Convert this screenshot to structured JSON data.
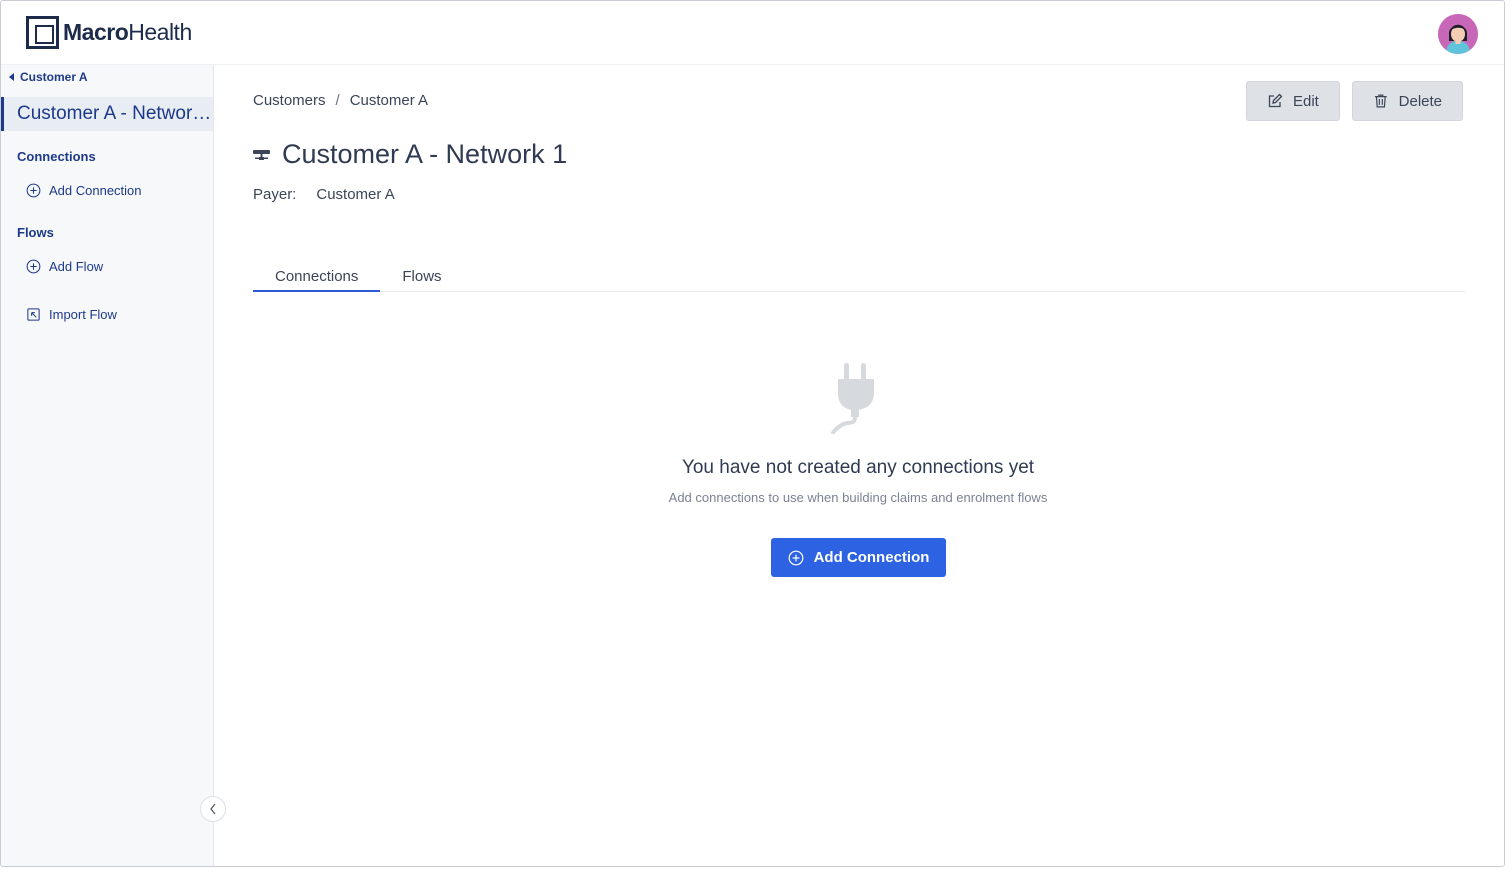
{
  "app": {
    "logo_bold": "Macro",
    "logo_light": "Health"
  },
  "sidebar": {
    "back_label": "Customer A",
    "current_item": "Customer A - Network 1",
    "sections": [
      {
        "title": "Connections",
        "actions": [
          {
            "label": "Add Connection",
            "icon": "plus-circle-icon"
          }
        ]
      },
      {
        "title": "Flows",
        "actions": [
          {
            "label": "Add Flow",
            "icon": "plus-circle-icon"
          },
          {
            "label": "Import Flow",
            "icon": "import-icon"
          }
        ]
      }
    ]
  },
  "breadcrumb": [
    "Customers",
    "Customer A"
  ],
  "breadcrumb_sep": "/",
  "toolbar": {
    "edit_label": "Edit",
    "delete_label": "Delete"
  },
  "page": {
    "title": "Customer A - Network 1",
    "payer_label": "Payer:",
    "payer_value": "Customer A"
  },
  "tabs": [
    {
      "label": "Connections",
      "active": true
    },
    {
      "label": "Flows",
      "active": false
    }
  ],
  "empty_state": {
    "icon": "plug-icon",
    "title": "You have not created any connections yet",
    "subtitle": "Add connections to use when building claims and enrolment flows",
    "button_label": "Add Connection"
  },
  "colors": {
    "primary": "#2d63e2",
    "nav": "#1d3a8a",
    "grey_button": "#dee1e6"
  }
}
